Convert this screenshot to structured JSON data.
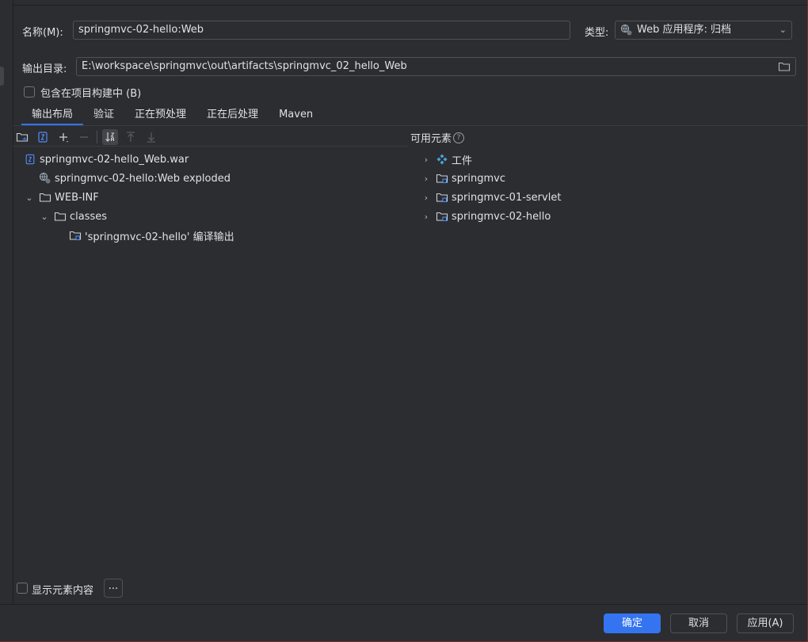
{
  "name": {
    "label": "名称(M):",
    "value": "springmvc-02-hello:Web"
  },
  "type": {
    "label": "类型:",
    "value": "Web 应用程序: 归档"
  },
  "output": {
    "label": "输出目录:",
    "value": "E:\\workspace\\springmvc\\out\\artifacts\\springmvc_02_hello_Web"
  },
  "include_build": {
    "label": "包含在项目构建中 (B)",
    "checked": false
  },
  "tabs": [
    {
      "label": "输出布局",
      "active": true
    },
    {
      "label": "验证",
      "active": false
    },
    {
      "label": "正在预处理",
      "active": false
    },
    {
      "label": "正在后处理",
      "active": false
    },
    {
      "label": "Maven",
      "active": false
    }
  ],
  "layout_tree": [
    {
      "label": "springmvc-02-hello_Web.war",
      "icon": "war-archive-icon"
    },
    {
      "label": "springmvc-02-hello:Web exploded",
      "icon": "web-facet-icon"
    },
    {
      "label": "WEB-INF",
      "icon": "folder-icon"
    },
    {
      "label": "classes",
      "icon": "folder-icon"
    },
    {
      "label": "'springmvc-02-hello' 编译输出",
      "icon": "module-output-icon"
    }
  ],
  "available": {
    "title": "可用元素",
    "items": [
      {
        "label": "工件",
        "icon": "artifacts-icon"
      },
      {
        "label": "springmvc",
        "icon": "module-folder-icon"
      },
      {
        "label": "springmvc-01-servlet",
        "icon": "module-folder-icon"
      },
      {
        "label": "springmvc-02-hello",
        "icon": "module-folder-icon"
      }
    ]
  },
  "show_content": {
    "label": "显示元素内容",
    "more_label": "..."
  },
  "buttons": {
    "ok": "确定",
    "cancel": "取消",
    "apply": "应用(A)"
  },
  "colors": {
    "accent": "#3574f0",
    "background": "#2b2d30",
    "text": "#dfe1e5"
  }
}
